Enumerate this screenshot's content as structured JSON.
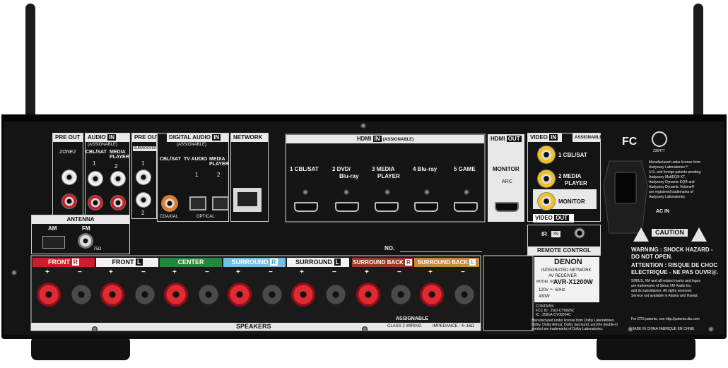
{
  "panel": {
    "pre_out_1": "PRE OUT",
    "zone2": "ZONE2",
    "audio_in": "AUDIO",
    "audio_in_tag": "IN",
    "assignable": "(ASSIGNABLE)",
    "audio_1": "CBL/SAT",
    "audio_2": "MEDIA PLAYER",
    "num_1": "1",
    "num_2": "2",
    "pre_out_2": "PRE OUT",
    "subwoofer": "SUBWOOFER",
    "digital_audio": "DIGITAL AUDIO",
    "digital_in_tag": "IN",
    "coaxial_label": "CBL/SAT",
    "tv_audio": "TV AUDIO",
    "media_player_opt": "MEDIA PLAYER",
    "coaxial": "COAXIAL",
    "optical": "OPTICAL",
    "network": "NETWORK",
    "hdmi_in": "HDMI",
    "hdmi_in_tag": "IN",
    "hdmi_assignable": "(ASSIGNABLE)",
    "hdmi_1": "1 CBL/SAT",
    "hdmi_2": "2 DVD/",
    "hdmi_2b": "Blu-ray",
    "hdmi_3": "3 MEDIA",
    "hdmi_3b": "PLAYER",
    "hdmi_4": "4 Blu-ray",
    "hdmi_5": "5 GAME",
    "hdmi_out": "HDMI",
    "hdmi_out_tag": "OUT",
    "monitor": "MONITOR",
    "arc": "ARC",
    "video_in": "VIDEO",
    "video_in_tag": "IN",
    "video_assignable": "ASSIGNABLE",
    "video_1": "1 CBL/SAT",
    "video_2": "2 MEDIA",
    "video_2b": "PLAYER",
    "video_monitor": "MONITOR",
    "video_out": "VIDEO",
    "video_out_tag": "OUT",
    "ir": "IR",
    "ir_in": "IN",
    "remote_control": "REMOTE CONTROL",
    "antenna": "ANTENNA",
    "am": "AM",
    "fm": "FM",
    "ohm": "75Ω",
    "no_label": "NO.",
    "speakers": "SPEAKERS",
    "class2": "CLASS 2 WIRING",
    "impedance": "IMPEDANCE : 4~16Ω",
    "sp_front_r": "FRONT",
    "sp_front_r_tag": "R",
    "sp_front_l": "FRONT",
    "sp_front_l_tag": "L",
    "sp_center": "CENTER",
    "sp_surround_r": "SURROUND",
    "sp_surround_r_tag": "R",
    "sp_surround_l": "SURROUND",
    "sp_surround_l_tag": "L",
    "sp_sb_r": "SURROUND BACK",
    "sp_sb_r_tag": "R",
    "sp_sb_l": "SURROUND BACK",
    "sp_sb_l_tag": "L",
    "sp_assignable": "ASSIGNABLE",
    "brand": "DENON",
    "product_1": "INTEGRATED NETWORK",
    "product_2": "AV RECEIVER",
    "model_prefix": "MODEL NO.",
    "model": "AVR-X1200W",
    "power_1": "120V ～ 60Hz",
    "power_2": "430W",
    "ac_in": "AC IN",
    "fc": "FC",
    "caution": "CAUTION",
    "warning_1": "WARNING : SHOCK HAZARD -",
    "warning_2": "DO NOT OPEN.",
    "attention_1": "ATTENTION : RISQUE DE CHOC",
    "attention_2": "ELECTRIQUE - NE PAS OUVRIR.",
    "audyssey_1": "Manufactured under license from",
    "audyssey_2": "Audyssey Laboratories™",
    "audyssey_3": "U.S. and foreign patents pending.",
    "audyssey_4": "Audyssey MultEQ® XT,",
    "audyssey_5": "Audyssey Dynamic EQ® and",
    "audyssey_6": "Audyssey Dynamic Volume®",
    "audyssey_7": "are registered trademarks of",
    "audyssey_8": "Audyssey Laboratories.",
    "sirius_1": "SIRIUS, XM and all related marks and logos",
    "sirius_2": "are trademarks of Sirius XM Radio Inc.",
    "sirius_3": "and its subsidiaries. All rights reserved.",
    "sirius_4": "Service not available in Alaska and Hawaii.",
    "dolby_1": "Manufactured under license from Dolby Laboratories.",
    "dolby_2": "Dolby, Dolby Atmos, Dolby Surround, and the double-D",
    "dolby_3": "symbol are trademarks of Dolby Laboratories.",
    "dts": "For DTS patents, see http://patents.dts.com",
    "made_in": "MADE IN CHINA  FABRIQUE EN CHINE",
    "contains": "CONTAINS",
    "fcc": "FCC ID : 2GD-CY0926C",
    "ic": "IC : 2581A-CY09204C",
    "csa": "236477"
  },
  "colors": {
    "chassis": "#0b0b0b",
    "label_grey": "#e6e6e6",
    "front_r": "#c8202a",
    "front_l": "#ffffff",
    "center": "#1f8a3a",
    "surround_r": "#6fc3e8",
    "surround_l": "#ffffff",
    "surround_back_r": "#9b3b2a",
    "surround_back_l": "#c98a3b"
  }
}
